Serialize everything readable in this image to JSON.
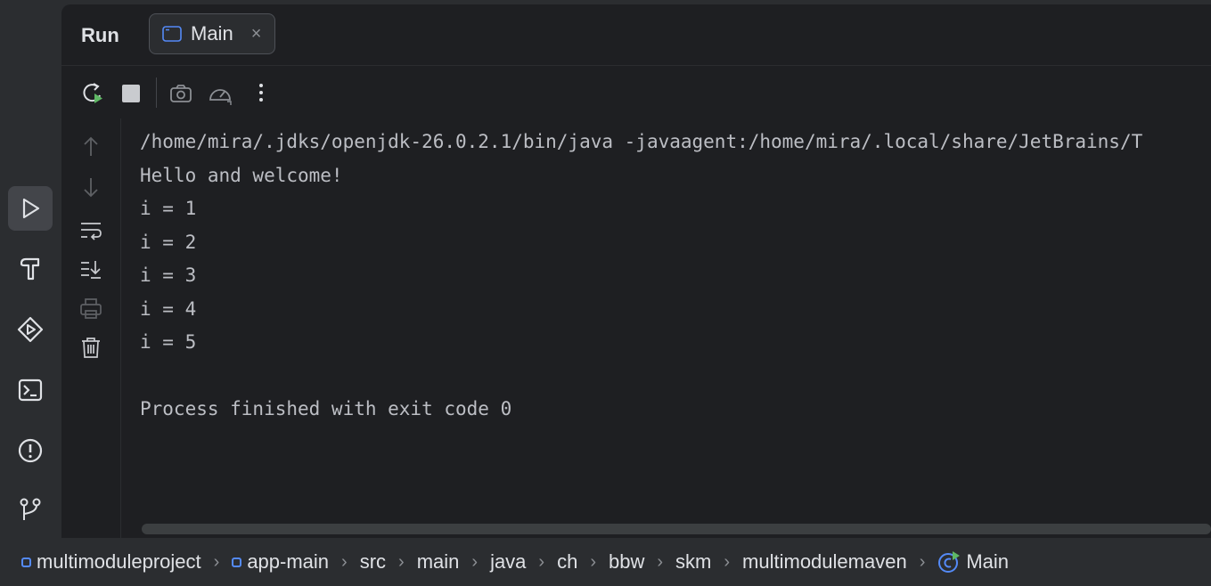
{
  "tool_window": {
    "title": "Run",
    "tab": {
      "label": "Main",
      "close": "×"
    }
  },
  "left_strip": {
    "items": [
      "run-icon",
      "build-hammer-icon",
      "services-icon",
      "terminal-icon",
      "problems-icon",
      "git-icon"
    ]
  },
  "toolbar": [
    "rerun-icon",
    "stop-icon",
    "screenshot-icon",
    "profiler-icon",
    "more-icon"
  ],
  "gutter": [
    "scroll-up-icon",
    "scroll-down-icon",
    "soft-wrap-icon",
    "scroll-to-end-icon",
    "print-icon",
    "clear-icon"
  ],
  "console": {
    "lines": [
      "/home/mira/.jdks/openjdk-26.0.2.1/bin/java -javaagent:/home/mira/.local/share/JetBrains/T",
      "Hello and welcome!",
      "i = 1",
      "i = 2",
      "i = 3",
      "i = 4",
      "i = 5",
      "",
      "Process finished with exit code 0"
    ]
  },
  "breadcrumbs": [
    {
      "label": "multimoduleproject",
      "icon": "module-icon"
    },
    {
      "label": "app-main",
      "icon": "module-icon"
    },
    {
      "label": "src"
    },
    {
      "label": "main"
    },
    {
      "label": "java"
    },
    {
      "label": "ch"
    },
    {
      "label": "bbw"
    },
    {
      "label": "skm"
    },
    {
      "label": "multimodulemaven"
    },
    {
      "label": "Main",
      "icon": "run-class-icon"
    }
  ],
  "colors": {
    "accent": "#548af7",
    "run_green": "#5fb865",
    "background": "#1e1f22"
  }
}
